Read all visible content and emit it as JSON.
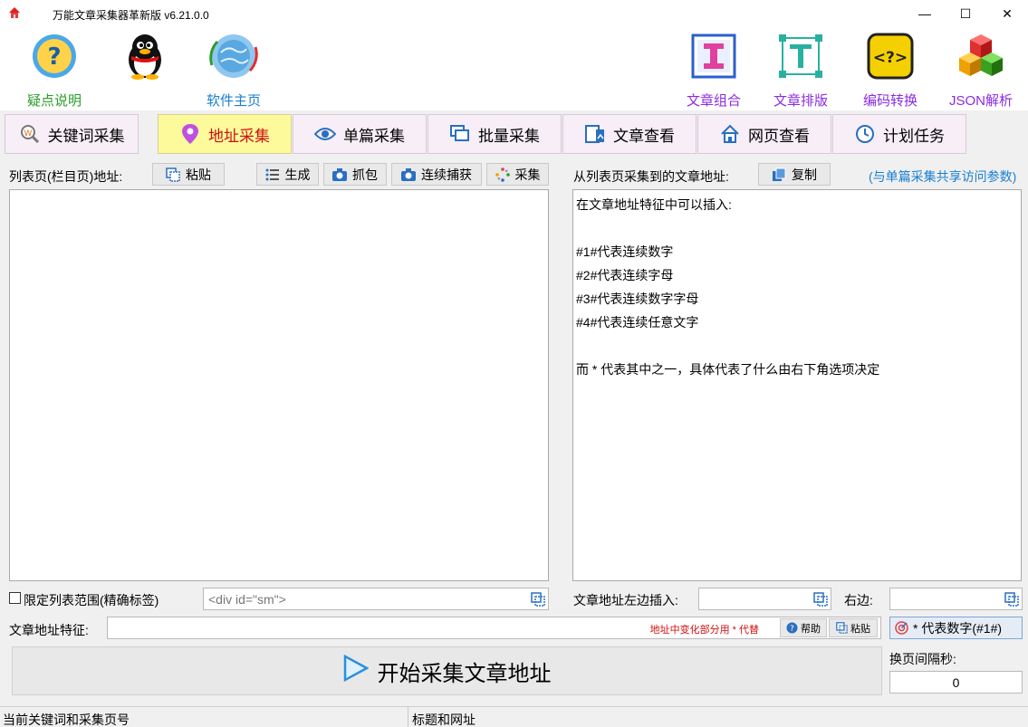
{
  "window": {
    "title": "万能文章采集器革新版 v6.21.0.0",
    "controls": [
      "—",
      "☐",
      "✕"
    ]
  },
  "toolbar": {
    "left_tools": [
      {
        "label": "疑点说明",
        "icon": "help-icon",
        "color": "#2a9d2a"
      },
      {
        "label": "",
        "icon": "qq-penguin-icon",
        "color": "#000000"
      },
      {
        "label": "软件主页",
        "icon": "globe-icon",
        "color": "#1a7fd0"
      }
    ],
    "right_tools": [
      {
        "label": "文章组合",
        "icon": "text-combine-icon",
        "color": "#8a2be2"
      },
      {
        "label": "文章排版",
        "icon": "text-layout-icon",
        "color": "#8a2be2"
      },
      {
        "label": "编码转换",
        "icon": "code-convert-icon",
        "color": "#8a2be2"
      },
      {
        "label": "JSON解析",
        "icon": "json-cubes-icon",
        "color": "#8a2be2"
      }
    ]
  },
  "tabs": [
    {
      "label": "关键词采集",
      "icon": "keyword-search-icon",
      "active": false
    },
    {
      "label": "地址采集",
      "icon": "location-pin-icon",
      "active": true
    },
    {
      "label": "单篇采集",
      "icon": "eye-icon",
      "active": false
    },
    {
      "label": "批量采集",
      "icon": "batch-windows-icon",
      "active": false
    },
    {
      "label": "文章查看",
      "icon": "article-view-icon",
      "active": false
    },
    {
      "label": "网页查看",
      "icon": "home-icon",
      "active": false
    },
    {
      "label": "计划任务",
      "icon": "clock-icon",
      "active": false
    }
  ],
  "left_panel": {
    "label": "列表页(栏目页)地址:",
    "paste_button": "粘贴",
    "actions": [
      "生成",
      "抓包",
      "连续捕获",
      "采集"
    ],
    "limit_checkbox": {
      "checked": false,
      "label": "限定列表范围(精确标签)"
    },
    "limit_input_placeholder": "<div id=\"sm\">"
  },
  "right_panel": {
    "label": "从列表页采集到的文章地址:",
    "copy_button": "复制",
    "shared_note": "(与单篇采集共享访问参数)",
    "lines": [
      "在文章地址特征中可以插入:",
      "",
      "#1#代表连续数字",
      "#2#代表连续字母",
      "#3#代表连续数字字母",
      "#4#代表连续任意文字",
      "",
      "而 * 代表其中之一，具体代表了什么由右下角选项决定"
    ],
    "left_insert_label": "文章地址左边插入:",
    "right_insert_label": "右边:"
  },
  "feature_row": {
    "label": "文章地址特征:",
    "hint": "地址中变化部分用 * 代替",
    "help_button": "帮助",
    "paste_button": "粘贴",
    "wildcard_select": "* 代表数字(#1#)"
  },
  "start_button": "开始采集文章地址",
  "interval": {
    "label": "换页间隔秒:",
    "value": "0"
  },
  "status": {
    "left": "当前关键词和采集页号",
    "right": "标题和网址"
  },
  "colors": {
    "active_tab_bg": "#fdfa9c",
    "active_tab_text": "#d01010",
    "tab_bg": "#f7eef7",
    "hint_red": "#d01010",
    "link_blue": "#1a7fd0"
  }
}
